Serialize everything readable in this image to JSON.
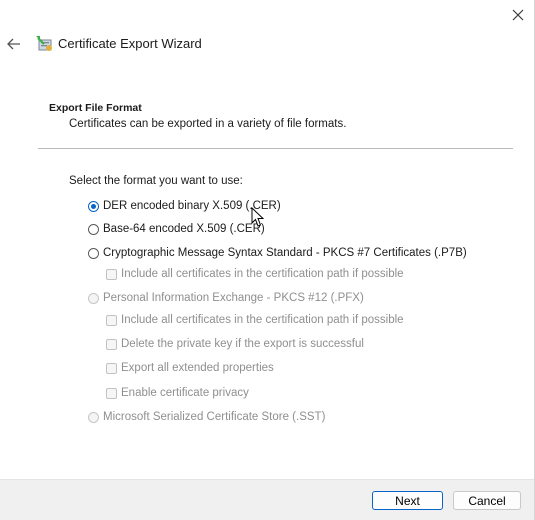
{
  "window": {
    "title": "Certificate Export Wizard",
    "icons": {
      "close": "close-icon",
      "back": "back-arrow-icon",
      "wizard": "certificate-wizard-icon"
    }
  },
  "section": {
    "title": "Export File Format",
    "description": "Certificates can be exported in a variety of file formats."
  },
  "format_prompt": "Select the format you want to use:",
  "options": {
    "der": {
      "label": "DER encoded binary X.509 (.CER)",
      "selected": true,
      "enabled": true
    },
    "base64": {
      "label": "Base-64 encoded X.509 (.CER)",
      "selected": false,
      "enabled": true
    },
    "pkcs7": {
      "label": "Cryptographic Message Syntax Standard - PKCS #7 Certificates (.P7B)",
      "selected": false,
      "enabled": true
    },
    "pkcs7_include_all": {
      "label": "Include all certificates in the certification path if possible",
      "checked": false,
      "enabled": false
    },
    "pfx": {
      "label": "Personal Information Exchange - PKCS #12 (.PFX)",
      "selected": false,
      "enabled": false
    },
    "pfx_include_all": {
      "label": "Include all certificates in the certification path if possible",
      "checked": false,
      "enabled": false
    },
    "pfx_delete_key": {
      "label": "Delete the private key if the export is successful",
      "checked": false,
      "enabled": false
    },
    "pfx_export_ext": {
      "label": "Export all extended properties",
      "checked": false,
      "enabled": false
    },
    "pfx_privacy": {
      "label": "Enable certificate privacy",
      "checked": false,
      "enabled": false
    },
    "sst": {
      "label": "Microsoft Serialized Certificate Store (.SST)",
      "selected": false,
      "enabled": false
    }
  },
  "buttons": {
    "next": "Next",
    "cancel": "Cancel"
  },
  "colors": {
    "accent": "#0a63c7",
    "disabled_text": "#8f8f8f",
    "footer_bg": "#f0f0f0"
  }
}
